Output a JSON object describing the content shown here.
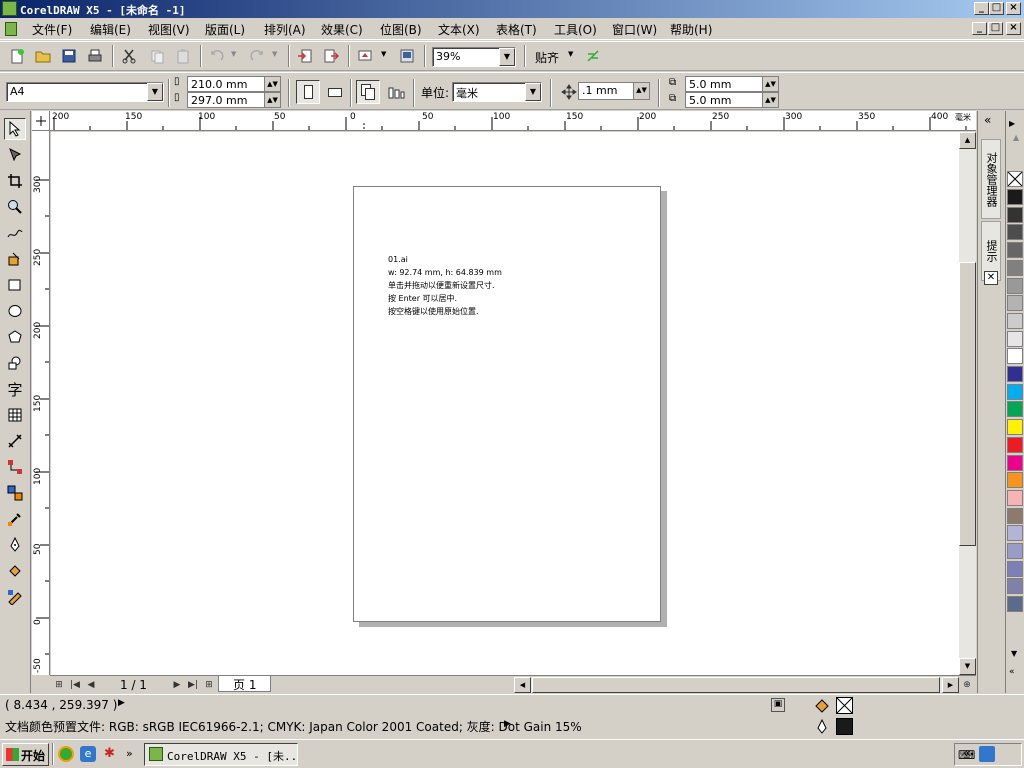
{
  "window": {
    "title": "CorelDRAW X5 - [未命名 -1]",
    "min": "_",
    "max": "□",
    "close": "×"
  },
  "menu": {
    "items": [
      "文件(F)",
      "编辑(E)",
      "视图(V)",
      "版面(L)",
      "排列(A)",
      "效果(C)",
      "位图(B)",
      "文本(X)",
      "表格(T)",
      "工具(O)",
      "窗口(W)",
      "帮助(H)"
    ]
  },
  "standard_toolbar": {
    "zoom_value": "39%",
    "snap_label": "贴齐"
  },
  "property_bar": {
    "paper_preset": "A4",
    "width": "210.0 mm",
    "height": "297.0 mm",
    "units_label": "单位:",
    "units_value": "毫米",
    "nudge": ".1 mm",
    "dup_x": "5.0 mm",
    "dup_y": "5.0 mm"
  },
  "rulers": {
    "horizontal": [
      "200",
      "150",
      "100",
      "50",
      "0",
      "50",
      "100",
      "150",
      "200",
      "250",
      "300",
      "350",
      "400"
    ],
    "horizontal_unit": "毫米",
    "vertical": [
      "300",
      "250",
      "200",
      "150",
      "100",
      "50",
      "0",
      "-50"
    ]
  },
  "canvas": {
    "tooltip_lines": [
      "01.ai",
      "w: 92.74 mm, h: 64.839 mm",
      "单击并拖动以便重新设置尺寸.",
      "按 Enter 可以居中.",
      "按空格键以使用原始位置."
    ]
  },
  "page_nav": {
    "page_count": "1 / 1",
    "page_tab": "页 1"
  },
  "docker": {
    "tab1": "对象管理器",
    "tab2": "提示"
  },
  "palette": {
    "colors": [
      "#1a1a1a",
      "#333333",
      "#4d4d4d",
      "#666666",
      "#808080",
      "#999999",
      "#b3b3b3",
      "#cccccc",
      "#e6e6e6",
      "#ffffff",
      "#2e3192",
      "#00aeef",
      "#00a651",
      "#fff200",
      "#ed1c24",
      "#ec008c",
      "#f7941d",
      "#f8b4b4",
      "#8c7b6b",
      "#b4b4d8",
      "#9b9bc8",
      "#7f7fb8",
      "#8080a8",
      "#5c6b8a"
    ]
  },
  "status": {
    "coords": "( 8.434 , 259.397 )",
    "profile": "文档颜色预置文件: RGB: sRGB IEC61966-2.1; CMYK: Japan Color 2001 Coated; 灰度: Dot Gain 15%"
  },
  "taskbar": {
    "start": "开始",
    "task_item": "CorelDRAW X5 - [未..."
  }
}
